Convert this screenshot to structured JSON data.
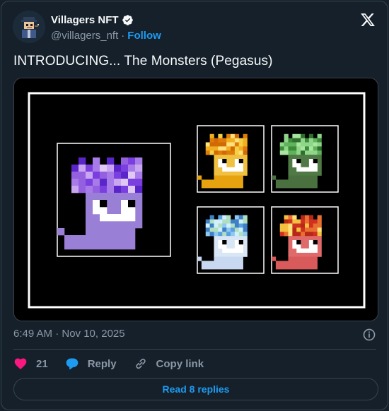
{
  "author": {
    "display_name": "Villagers NFT",
    "handle": "@villagers_nft",
    "separator": "·",
    "follow_label": "Follow"
  },
  "tweet": {
    "text": "INTRODUCING... The Monsters (Pegasus)"
  },
  "media": {
    "main_monster_hair": [
      "#c9a6f0",
      "#a87ce8",
      "#7b3fe0",
      "#5a25c9",
      "#e0c8f5",
      "#9460e0"
    ],
    "main_monster_body": "#9a7fd6",
    "variants": [
      {
        "name": "orange-monster",
        "hair": [
          "#f5d045",
          "#f0b020",
          "#e07b0a",
          "#ffe07a",
          "#d06a05"
        ],
        "body": "#e6a20f",
        "face": "#f0c040"
      },
      {
        "name": "green-monster",
        "hair": [
          "#8fd68a",
          "#5fb35a",
          "#3d8a3a",
          "#a8e6a0",
          "#2f6e2d"
        ],
        "body": "#4a7040",
        "face": "#507a45"
      },
      {
        "name": "blue-monster",
        "hair": [
          "#8fc8f0",
          "#5aa0e0",
          "#b0e0c0",
          "#3f7fc8",
          "#d0f0ff"
        ],
        "body": "#c8d8f0",
        "face": "#d8e6f6"
      },
      {
        "name": "red-monster",
        "hair": [
          "#f5c040",
          "#e87030",
          "#d03020",
          "#ffe07a",
          "#b82818"
        ],
        "body": "#d85a5a",
        "face": "#e06a6a"
      }
    ]
  },
  "meta": {
    "timestamp": "6:49 AM · Nov 10, 2025"
  },
  "actions": {
    "like_count": "21",
    "reply_label": "Reply",
    "copy_label": "Copy link"
  },
  "footer": {
    "read_replies_label": "Read 8 replies"
  },
  "colors": {
    "background": "#15202b",
    "accent": "#1d9bf0",
    "like": "#f91880",
    "muted": "#8b98a5"
  }
}
